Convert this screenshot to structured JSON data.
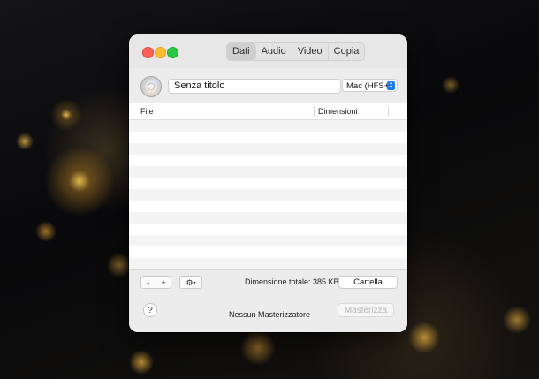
{
  "window": {
    "tabs": [
      {
        "label": "Dati",
        "active": true
      },
      {
        "label": "Audio",
        "active": false
      },
      {
        "label": "Video",
        "active": false
      },
      {
        "label": "Copia",
        "active": false
      }
    ]
  },
  "disc": {
    "title_value": "Senza titolo",
    "format_selected": "Mac (HFS+)"
  },
  "table": {
    "columns": [
      "File",
      "Dimensioni"
    ],
    "rows": []
  },
  "toolbar": {
    "remove_label": "-",
    "add_label": "+",
    "gear_label": "⚙",
    "total_size": "Dimensione totale: 385 KB",
    "folder_label": "Cartella"
  },
  "footer": {
    "help_label": "?",
    "burner_status": "Nessun Masterizzatore",
    "burn_label": "Masterizza"
  },
  "colors": {
    "close": "#fe5f57",
    "minimize": "#febc2e",
    "maximize": "#28c840",
    "accent": "#1e7cf2"
  }
}
